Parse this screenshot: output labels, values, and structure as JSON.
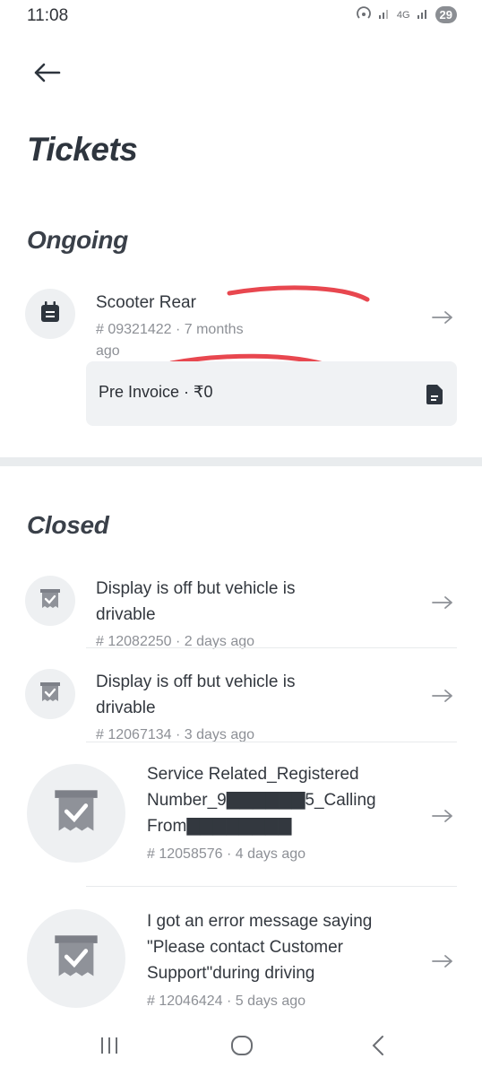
{
  "status": {
    "time": "11:08",
    "network": "4G",
    "battery": "29"
  },
  "header": {
    "title": "Tickets"
  },
  "ongoing": {
    "section_title": "Ongoing",
    "ticket": {
      "title": "Scooter Rear",
      "meta_line1": "# 09321422 · 7 months",
      "meta_line2": "ago",
      "invoice_label": "Pre Invoice · ₹0"
    }
  },
  "closed": {
    "section_title": "Closed",
    "tickets": [
      {
        "title_line1": "Display is off but vehicle is",
        "title_line2": "drivable",
        "title_line3": "",
        "meta": "# 12082250 · 2 days ago"
      },
      {
        "title_line1": "Display is off but vehicle is",
        "title_line2": "drivable",
        "title_line3": "",
        "meta": "# 12067134 · 3 days ago"
      },
      {
        "title_line1": "Service Related_Registered",
        "title_line2": "Number_9▇▇▇▇▇▇5_Calling",
        "title_line3": "From▇▇▇▇▇▇▇▇",
        "meta": "# 12058576 · 4 days ago"
      },
      {
        "title_line1": "I got an error message saying",
        "title_line2": "\"Please contact Customer",
        "title_line3": "Support\"during driving",
        "meta": "# 12046424 · 5 days ago"
      }
    ]
  },
  "colors": {
    "accent_annotation": "#e8474f",
    "icon_bg": "#eef0f2",
    "card_bg": "#f0f2f4"
  }
}
